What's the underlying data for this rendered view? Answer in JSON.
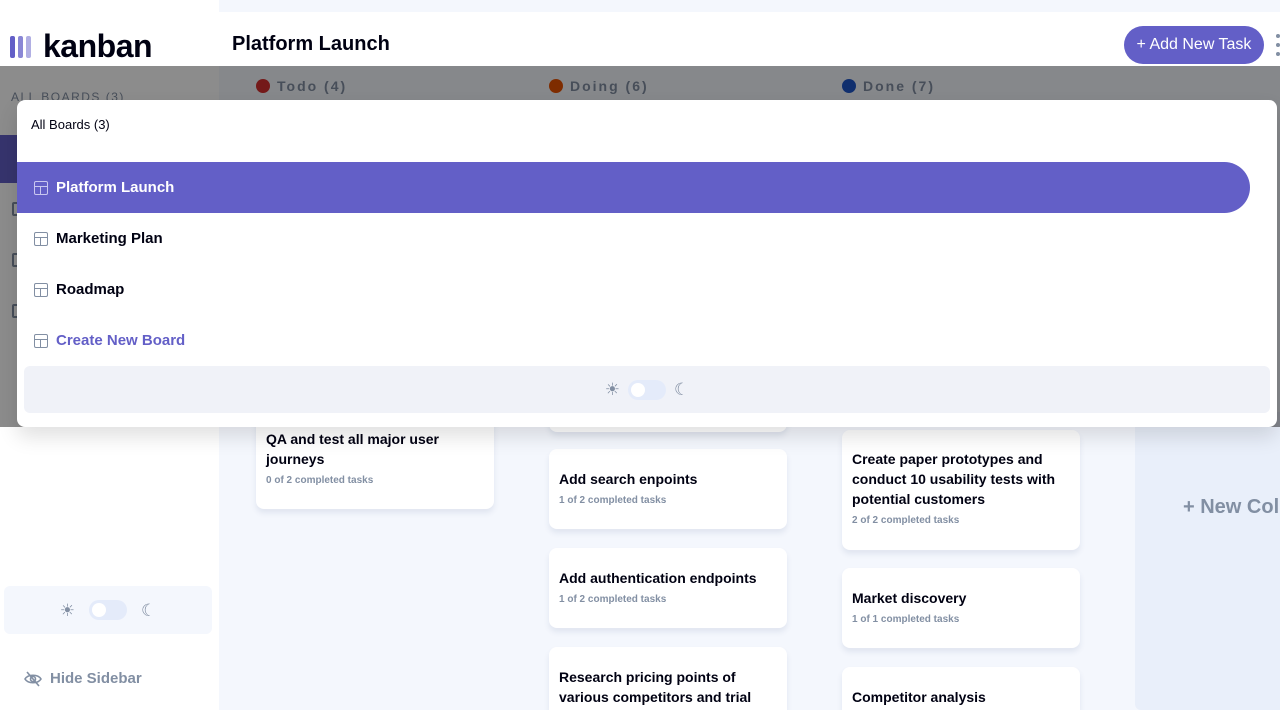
{
  "app": {
    "logo_text": "kanban"
  },
  "sidebar": {
    "all_boards_label": "ALL BOARDS (3)",
    "hide_sidebar_label": "Hide Sidebar"
  },
  "header": {
    "board_title": "Platform Launch",
    "add_task_label": "+ Add New Task"
  },
  "columns": [
    {
      "label": "Todo (4)",
      "color": "#d32f2f"
    },
    {
      "label": "Doing (6)",
      "color": "#e65100"
    },
    {
      "label": "Done (7)",
      "color": "#1e56c9"
    }
  ],
  "cards": {
    "todo": [
      {
        "title": "QA and test all major user journeys",
        "subtasks": "0 of 2 completed tasks"
      }
    ],
    "doing": [
      {
        "title": "Add search enpoints",
        "subtasks": "1 of 2 completed tasks"
      },
      {
        "title": "Add authentication endpoints",
        "subtasks": "1 of 2 completed tasks"
      },
      {
        "title": "Research pricing points of various competitors and trial",
        "subtasks": ""
      }
    ],
    "done": [
      {
        "title": "Create paper prototypes and conduct 10 usability tests with potential customers",
        "subtasks": "2 of 2 completed tasks"
      },
      {
        "title": "Market discovery",
        "subtasks": "1 of 1 completed tasks"
      },
      {
        "title": "Competitor analysis",
        "subtasks": ""
      }
    ]
  },
  "new_column_label": "+ New Col",
  "modal": {
    "heading": "All Boards (3)",
    "boards": [
      {
        "label": "Platform Launch",
        "active": true
      },
      {
        "label": "Marketing Plan",
        "active": false
      },
      {
        "label": "Roadmap",
        "active": false
      }
    ],
    "create_label": "Create New Board"
  },
  "theme": {
    "light_icon": "sun-icon",
    "dark_icon": "moon-icon",
    "dark_mode": false
  },
  "colors": {
    "accent": "#635fc7",
    "background": "#f4f7fd",
    "muted_text": "#828fa3",
    "text": "#000112"
  }
}
